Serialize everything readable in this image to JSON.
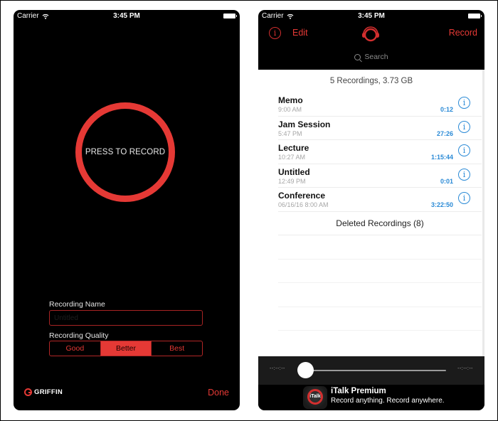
{
  "left_screen": {
    "status_bar": {
      "carrier": "Carrier",
      "time": "3:45 PM"
    },
    "record_button": {
      "label": "PRESS TO RECORD"
    },
    "recording_name": {
      "label": "Recording Name",
      "value": "",
      "placeholder": "Untitled"
    },
    "recording_quality": {
      "label": "Recording Quality",
      "options": [
        "Good",
        "Better",
        "Best"
      ],
      "selected": "Better"
    },
    "brand": "GRIFFIN",
    "done_label": "Done"
  },
  "right_screen": {
    "status_bar": {
      "carrier": "Carrier",
      "time": "3:45 PM"
    },
    "nav": {
      "edit_label": "Edit",
      "record_label": "Record"
    },
    "search": {
      "placeholder": "Search"
    },
    "summary": "5 Recordings, 3.73 GB",
    "recordings": [
      {
        "title": "Memo",
        "date": "9:00 AM",
        "duration": "0:12"
      },
      {
        "title": "Jam Session",
        "date": "5:47 PM",
        "duration": "27:26"
      },
      {
        "title": "Lecture",
        "date": "10:27 AM",
        "duration": "1:15:44"
      },
      {
        "title": "Untitled",
        "date": "12:49 PM",
        "duration": "0:01"
      },
      {
        "title": "Conference",
        "date": "06/16/16 8:00 AM",
        "duration": "3:22:50"
      }
    ],
    "deleted_label": "Deleted Recordings (8)",
    "player": {
      "elapsed": "--:--:--",
      "remaining": "--:--:--",
      "progress": 0
    },
    "promo": {
      "icon_text": "iTalk",
      "title": "iTalk Premium",
      "tagline": "Record anything. Record anywhere."
    }
  },
  "colors": {
    "accent_red": "#e53935",
    "info_blue": "#2a8ad6"
  }
}
